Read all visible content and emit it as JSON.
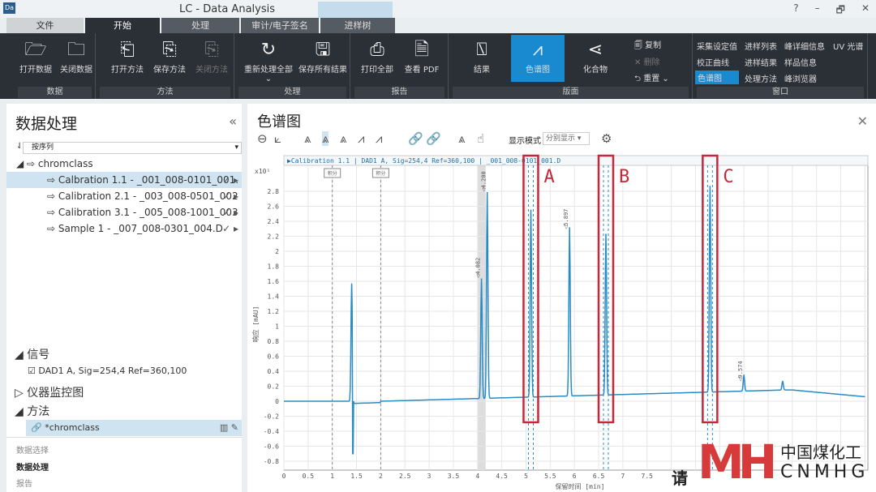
{
  "app": {
    "title": "LC - Data Analysis",
    "logo": "Da",
    "window_buttons": [
      "?",
      "–",
      "🗗",
      "✕"
    ]
  },
  "tabs": [
    {
      "label": "文件"
    },
    {
      "label": "开始"
    },
    {
      "label": "处理"
    },
    {
      "label": "审计/电子签名"
    },
    {
      "label": "进样树"
    }
  ],
  "ribbon": {
    "groups": [
      "数据",
      "方法",
      "处理",
      "报告",
      "版面",
      "窗口"
    ],
    "buttons": [
      "打开数据",
      "关闭数据",
      "打开方法",
      "保存方法",
      "关闭方法",
      "重新处理全部",
      "保存所有结果",
      "打印全部",
      "查看 PDF",
      "结果",
      "色谱图",
      "化合物"
    ],
    "edit": [
      "复制",
      "删除",
      "重置"
    ],
    "window_items": [
      "采集设定值",
      "进样列表",
      "峰详细信息",
      "UV 光谱",
      "校正曲线",
      "进样结果",
      "样品信息",
      "色谱图",
      "处理方法",
      "峰浏览器"
    ]
  },
  "left": {
    "title": "数据处理",
    "sort": "按序列",
    "root": "chromclass",
    "items": [
      "Calbration 1.1 - _001_008-0101_001.",
      "Calibration 2.1 - _003_008-0501_002",
      "Calibration 3.1 - _005_008-1001_003",
      "Sample 1 - _007_008-0301_004.D"
    ],
    "signal_title": "信号",
    "signal": "DAD1 A, Sig=254,4 Ref=360,100",
    "monitor_title": "仪器监控图",
    "method_title": "方法",
    "method": "*chromclass",
    "nav": [
      "数据选择",
      "数据处理",
      "报告"
    ]
  },
  "main": {
    "title": "色谱图",
    "display_mode_label": "显示模式",
    "display_mode": "分别显示"
  },
  "chart_data": {
    "type": "line",
    "header": "▶Calibration 1.1 | DAD1 A, Sig=254,4 Ref=360,100 | _001_008-0101_001.D",
    "xlabel": "保留时间 [min]",
    "ylabel": "响应 [mAU]",
    "yexp": "x10¹",
    "xlim": [
      0,
      12
    ],
    "ylim": [
      -0.85,
      3.0
    ],
    "xticks": [
      0,
      0.5,
      1,
      1.5,
      2,
      2.5,
      3,
      3.5,
      4,
      4.5,
      5,
      5.5,
      6,
      6.5,
      7,
      7.5
    ],
    "yticks": [
      -0.8,
      -0.6,
      -0.4,
      -0.2,
      0,
      0.2,
      0.4,
      0.6,
      0.8,
      1,
      1.2,
      1.4,
      1.6,
      1.8,
      2,
      2.2,
      2.4,
      2.6,
      2.8
    ],
    "peaks": [
      {
        "t": 1.4,
        "h": 1.6
      },
      {
        "t": 4.08,
        "h": 1.6,
        "label": "4.082"
      },
      {
        "t": 4.2,
        "h": 2.75,
        "label": "4.200"
      },
      {
        "t": 5.1,
        "h": 2.5,
        "label": "A"
      },
      {
        "t": 5.9,
        "h": 2.25,
        "label": "5.897"
      },
      {
        "t": 6.65,
        "h": 2.15,
        "label": "B"
      },
      {
        "t": 8.8,
        "h": 2.75,
        "label": "C"
      },
      {
        "t": 9.5,
        "h": 0.22,
        "label": "9.574"
      },
      {
        "t": 10.3,
        "h": 0.12
      }
    ],
    "annotations": [
      "A",
      "B",
      "C"
    ],
    "event_labels": [
      "积分",
      "积分"
    ]
  },
  "watermark": {
    "cn": "中国煤化工",
    "en": "CNMHG",
    "text": "请"
  }
}
